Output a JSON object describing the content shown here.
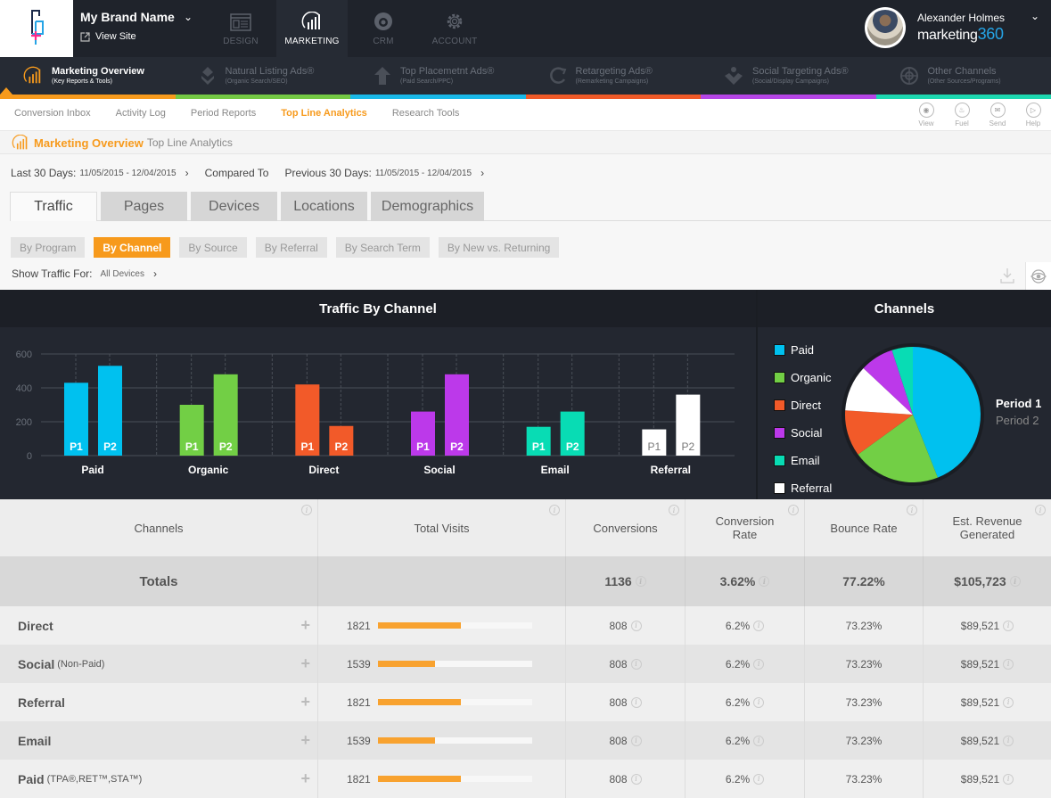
{
  "topbar": {
    "brand_name": "My Brand Name",
    "view_site": "View Site",
    "nav": [
      {
        "label": "DESIGN",
        "icon": "layout-icon",
        "active": false
      },
      {
        "label": "MARKETING",
        "icon": "bar-chart-icon",
        "active": true
      },
      {
        "label": "CRM",
        "icon": "eye-swirl-icon",
        "active": false
      },
      {
        "label": "ACCOUNT",
        "icon": "gear-icon",
        "active": false
      }
    ],
    "user_name": "Alexander Holmes",
    "product_logo_text": "marketing",
    "product_logo_num": "360"
  },
  "subnav": [
    {
      "title": "Marketing Overview",
      "subtitle": "(Key Reports & Tools)",
      "icon": "bar-chart-icon",
      "active": true
    },
    {
      "title": "Natural Listing Ads®",
      "subtitle": "(Organic Search/SEO)",
      "icon": "chevrons-down-icon",
      "active": false
    },
    {
      "title": "Top Placemetnt Ads®",
      "subtitle": "(Paid Search/PPC)",
      "icon": "arrow-up-icon",
      "active": false
    },
    {
      "title": "Retargeting Ads®",
      "subtitle": "(Remarketing Campaigns)",
      "icon": "retarget-icon",
      "active": false
    },
    {
      "title": "Social Targeting Ads®",
      "subtitle": "(Social/Display Campaigns)",
      "icon": "person-icon",
      "active": false
    },
    {
      "title": "Other Channels",
      "subtitle": "(Other Sources/Programs)",
      "icon": "target-icon",
      "active": false
    }
  ],
  "stripe_colors": [
    "#f79a1c",
    "#74c944",
    "#1ab9e8",
    "#f05a28",
    "#b645e6",
    "#1dd8b0"
  ],
  "thirdnav": {
    "tabs": [
      {
        "label": "Conversion Inbox",
        "active": false
      },
      {
        "label": "Activity Log",
        "active": false
      },
      {
        "label": "Period Reports",
        "active": false
      },
      {
        "label": "Top Line Analytics",
        "active": true
      },
      {
        "label": "Research Tools",
        "active": false
      }
    ],
    "tools": [
      {
        "label": "View",
        "icon": "eye-icon"
      },
      {
        "label": "Fuel",
        "icon": "flame-icon"
      },
      {
        "label": "Send",
        "icon": "mail-icon"
      },
      {
        "label": "Help",
        "icon": "play-icon"
      }
    ]
  },
  "breadcrumb": {
    "section": "Marketing Overview",
    "page": "Top Line Analytics"
  },
  "dates": {
    "current_label": "Last 30 Days:",
    "current_value": "11/05/2015 - 12/04/2015",
    "compared_to": "Compared To",
    "previous_label": "Previous 30 Days:",
    "previous_value": "11/05/2015 - 12/04/2015"
  },
  "main_tabs": [
    {
      "label": "Traffic",
      "active": true
    },
    {
      "label": "Pages",
      "active": false
    },
    {
      "label": "Devices",
      "active": false
    },
    {
      "label": "Locations",
      "active": false
    },
    {
      "label": "Demographics",
      "active": false
    }
  ],
  "sub_tabs": [
    {
      "label": "By Program",
      "active": false
    },
    {
      "label": "By Channel",
      "active": true
    },
    {
      "label": "By Source",
      "active": false
    },
    {
      "label": "By Referral",
      "active": false
    },
    {
      "label": "By Search Term",
      "active": false
    },
    {
      "label": "By New vs. Returning",
      "active": false
    }
  ],
  "show_traffic": {
    "label": "Show Traffic For:",
    "value": "All Devices"
  },
  "accent": "#f79a1c",
  "chart_data": [
    {
      "type": "bar",
      "title": "Traffic By Channel",
      "categories": [
        "Paid",
        "Organic",
        "Direct",
        "Social",
        "Email",
        "Referral"
      ],
      "colors": [
        "#00c1ef",
        "#72cf45",
        "#f25a29",
        "#bc39ea",
        "#08dcb4",
        "#ffffff"
      ],
      "series": [
        {
          "name": "P1",
          "values": [
            430,
            300,
            420,
            260,
            170,
            155
          ]
        },
        {
          "name": "P2",
          "values": [
            530,
            480,
            175,
            480,
            260,
            360
          ]
        }
      ],
      "ylim": [
        0,
        600
      ],
      "yticks": [
        0,
        200,
        400,
        600
      ],
      "xlabel": "",
      "ylabel": "",
      "grid": true
    },
    {
      "type": "pie",
      "title": "Channels",
      "labels": [
        "Paid",
        "Organic",
        "Direct",
        "Referral",
        "Social",
        "Email"
      ],
      "values": [
        44,
        21,
        11,
        11,
        8,
        5
      ],
      "colors": [
        "#00c1ef",
        "#72cf45",
        "#f25a29",
        "#ffffff",
        "#bc39ea",
        "#08dcb4"
      ],
      "legend": [
        "Paid",
        "Organic",
        "Direct",
        "Social",
        "Email",
        "Referral"
      ],
      "legend_colors": [
        "#00c1ef",
        "#72cf45",
        "#f25a29",
        "#bc39ea",
        "#08dcb4",
        "#ffffff"
      ],
      "legend_position": "left",
      "periods": {
        "selected": "Period 1",
        "other": "Period 2"
      }
    }
  ],
  "table": {
    "headers": [
      "Channels",
      "Total Visits",
      "Conversions",
      "Conversion Rate",
      "Bounce Rate",
      "Est. Revenue Generated"
    ],
    "totals": {
      "label": "Totals",
      "visits": "",
      "conversions": "1136",
      "conv_rate": "3.62%",
      "bounce": "77.22%",
      "revenue": "$105,723"
    },
    "rows": [
      {
        "name": "Direct",
        "sub": "",
        "visits": "1821",
        "visits_pct": 54,
        "conversions": "808",
        "conv_rate": "6.2%",
        "bounce": "73.23%",
        "revenue": "$89,521"
      },
      {
        "name": "Social",
        "sub": "(Non-Paid)",
        "visits": "1539",
        "visits_pct": 37,
        "conversions": "808",
        "conv_rate": "6.2%",
        "bounce": "73.23%",
        "revenue": "$89,521"
      },
      {
        "name": "Referral",
        "sub": "",
        "visits": "1821",
        "visits_pct": 54,
        "conversions": "808",
        "conv_rate": "6.2%",
        "bounce": "73.23%",
        "revenue": "$89,521"
      },
      {
        "name": "Email",
        "sub": "",
        "visits": "1539",
        "visits_pct": 37,
        "conversions": "808",
        "conv_rate": "6.2%",
        "bounce": "73.23%",
        "revenue": "$89,521"
      },
      {
        "name": "Paid",
        "sub": "(TPA®,RET™,STA™)",
        "visits": "1821",
        "visits_pct": 54,
        "conversions": "808",
        "conv_rate": "6.2%",
        "bounce": "73.23%",
        "revenue": "$89,521"
      }
    ]
  }
}
